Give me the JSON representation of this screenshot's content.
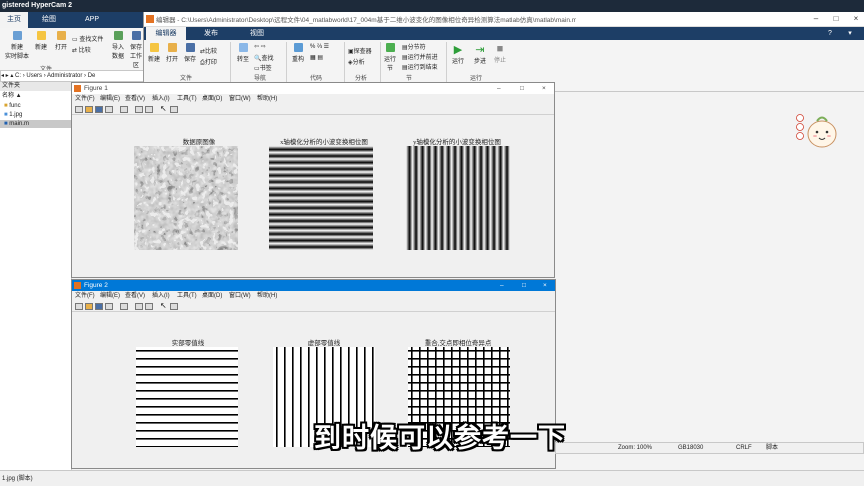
{
  "hypercam_label": "gistered HyperCam 2",
  "main_tabs": [
    {
      "label": "主页",
      "active": true
    },
    {
      "label": "绘图",
      "active": false
    },
    {
      "label": "APP",
      "active": false
    }
  ],
  "ribbon_left": {
    "buttons": [
      "新建\n实时脚本",
      "新建",
      "打开",
      "查找文件",
      "比较",
      "导入\n数据",
      "保存\n工作区"
    ],
    "group_label": "文件"
  },
  "editor": {
    "title": "编辑器 - C:\\Users\\Administrator\\Desktop\\远程文件\\04_matlabworld\\17_004m基于二维小波变化的图像相位奇异检测算法matlab仿真\\matlab\\main.m",
    "tabs": [
      {
        "label": "编辑器",
        "active": true
      },
      {
        "label": "发布",
        "active": false
      },
      {
        "label": "视图",
        "active": false
      }
    ],
    "buttons": {
      "new": "新建",
      "open": "打开",
      "save": "保存",
      "compare": "比较",
      "print": "打印",
      "goto": "转至",
      "find": "查找",
      "bookmark": "书签",
      "refactor": "重构",
      "profiler": "探查器",
      "analyze": "分析",
      "run_section_label": "运行\n节",
      "section_break": "分节符",
      "run_advance": "运行并前进",
      "run_to_end": "运行到结束",
      "run": "运行",
      "step": "步进",
      "stop": "停止"
    },
    "groups": [
      "文件",
      "导航",
      "代码",
      "分析",
      "节",
      "运行"
    ]
  },
  "address_bar": "C: › Users › Administrator › De",
  "file_panel": {
    "header": "文件夹",
    "column": "名称 ▲",
    "items": [
      {
        "name": "func",
        "selected": false
      },
      {
        "name": "1.jpg",
        "selected": false
      },
      {
        "name": "main.m",
        "selected": true
      }
    ]
  },
  "figure_menu": [
    "文件(F)",
    "编辑(E)",
    "查看(V)",
    "插入(I)",
    "工具(T)",
    "桌面(D)",
    "窗口(W)",
    "帮助(H)"
  ],
  "figure1": {
    "title": "Figure 1",
    "plots": [
      {
        "title": "数据原图像"
      },
      {
        "title": "x轴模化分析的小波变换相位图"
      },
      {
        "title": "y轴模化分析的小波变换相位图"
      }
    ]
  },
  "figure2": {
    "title": "Figure 2",
    "plots": [
      {
        "title": "实部零值线"
      },
      {
        "title": "虚部零值线"
      },
      {
        "title": "重合,交点即相位奇异点"
      }
    ]
  },
  "status": {
    "zoom": "Zoom: 100%",
    "encoding": "GB18030",
    "line_ending": "CRLF",
    "file_type": "脚本",
    "left": "1.jpg (脚本)"
  },
  "subtitle": "到时候可以参考一下",
  "colors": {
    "ribbon_blue": "#1d3e66",
    "figure2_title": "#0078d7",
    "figure1_title": "#ffffff"
  }
}
